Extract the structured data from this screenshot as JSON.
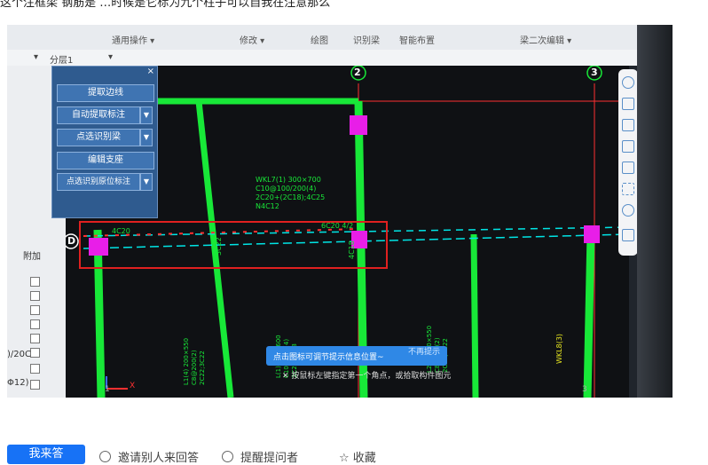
{
  "question_cut_text": "这个注框梁 钢筋是 …时候是它标为九个柱子可以自我在注意那么",
  "ribbon": {
    "common_ops": "通用操作 ▾",
    "modify": "修改 ▾",
    "draw": "绘图",
    "recognize_beam": "识别梁",
    "smart_layout": "智能布置",
    "beam_edit": "梁二次编辑 ▾"
  },
  "toolbar2": {
    "dropdown_caret": "▾",
    "layer": "分层1",
    "layer_caret": "▾"
  },
  "float_panel": {
    "close": "×",
    "buttons": [
      "提取边线",
      "自动提取标注",
      "点选识别梁",
      "编辑支座",
      "点选识别原位标注"
    ]
  },
  "left_panel": {
    "header": "附加",
    "label_a": ")/20C",
    "label_b": "Φ12)"
  },
  "axes": {
    "a": "2",
    "b": "3",
    "c": "D"
  },
  "cad_labels": {
    "beam_note_1": "WKL7(1) 300×700",
    "beam_note_2": "C10@100/200(4)",
    "beam_note_3": "2C20+(2C18);4C25",
    "beam_note_4": "N4C12",
    "top_left_mark": "4C20",
    "top_right_mark": "6C20 4/2",
    "v1": "3C22",
    "v2": "4C18",
    "side1": "L1(4) 200×550",
    "side2": "C8@200(2)",
    "side3": "2C22;3C22",
    "side4": "L(1) 300×600",
    "side5": "C10@200(4)",
    "side6": "2C22;4C18",
    "side7": "L2(3) 200×550",
    "side8": "C8@200(2)",
    "side9": "2C22;3C22",
    "yellow": "WKL8(3)",
    "ucs": "X",
    "grid1": "1",
    "grid3": "3"
  },
  "tooltip": {
    "text": "点击图标可调节提示信息位置~",
    "dismiss": "不再提示"
  },
  "status_text": "按鼠标左键指定第一个角点，或拾取构件图元",
  "bottom": {
    "answer": "我来答",
    "invite": "邀请别人来回答",
    "remind": "提醒提问者",
    "collect": "收藏"
  },
  "colors": {
    "beam_green": "#18e838",
    "axis_red": "#ff3030",
    "support_magenta": "#e81ee8",
    "highlight_red": "#e02020"
  }
}
